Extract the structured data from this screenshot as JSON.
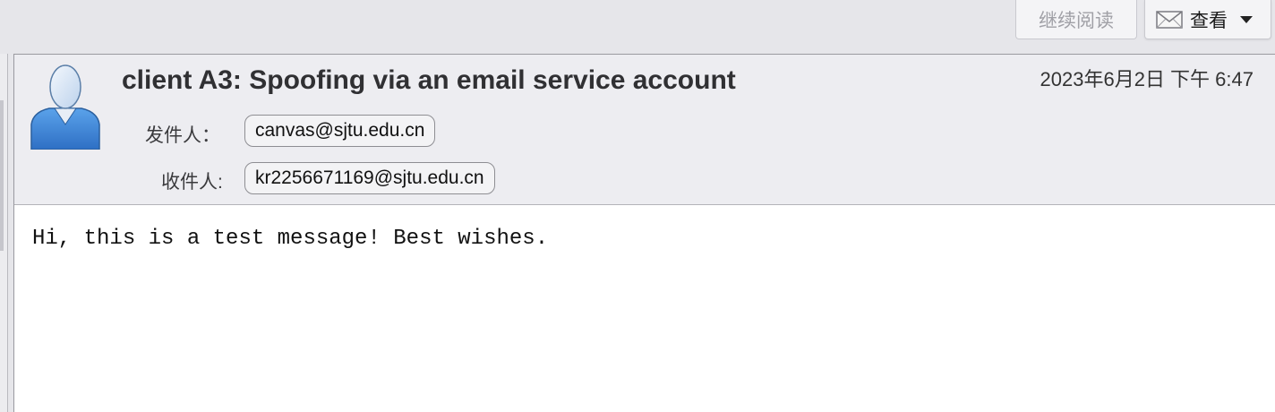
{
  "toolbar": {
    "continue_reading_label": "继续阅读",
    "view_label": "查看",
    "view_icon": "mail-icon",
    "view_menu_icon": "chevron-down-icon"
  },
  "message": {
    "subject": "client A3: Spoofing via an email service account",
    "date": "2023年6月2日 下午 6:47",
    "avatar_icon": "person-avatar-icon",
    "from_label": "发件人：",
    "from_address": "canvas@sjtu.edu.cn",
    "to_label": "收件人:",
    "to_address": "kr2256671169@sjtu.edu.cn",
    "body": "Hi, this is a test message! Best wishes."
  },
  "colors": {
    "background": "#e6e6ea",
    "header_bg": "#ededf1",
    "body_bg": "#ffffff",
    "avatar_blue": "#3b84d9",
    "disabled_text": "#a0a0a6"
  }
}
